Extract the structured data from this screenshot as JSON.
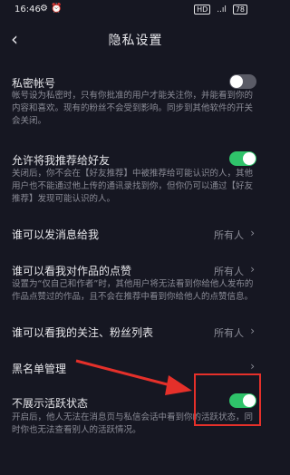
{
  "status_bar": {
    "time": "16:46",
    "left_icons": "⚙ ⏰",
    "hd": "HD",
    "signal": "..ıl",
    "battery": "78"
  },
  "header": {
    "back_icon": "chevron-left",
    "title": "隐私设置"
  },
  "settings": [
    {
      "title": "私密帐号",
      "description": "帐号设为私密时，只有你批准的用户才能关注你，并能看到你的内容和喜欢。现有的粉丝不会受到影响。同步到其他软件的开关会关闭。",
      "toggle": false
    },
    {
      "title": "允许将我推荐给好友",
      "description": "关闭后，你不会在【好友推荐】中被推荐给可能认识的人，其他用户也不能通过他上传的通讯录找到你，但你仍可以通过【好友推荐】发现可能认识的人。",
      "toggle": true
    },
    {
      "title": "谁可以发消息给我",
      "value": "所有人"
    },
    {
      "title": "谁可以看我对作品的点赞",
      "value": "所有人",
      "description": "设置为“仅自己和作者”时，其他用户将无法看到你给他人发布的作品点赞过的作品，且不会在推荐中看到你给他人的点赞信息。"
    },
    {
      "title": "谁可以看我的关注、粉丝列表",
      "value": "所有人"
    },
    {
      "title": "黑名单管理"
    },
    {
      "title": "不展示活跃状态",
      "description": "开启后，他人无法在消息页与私信会话中看到你的活跃状态，同时你也无法查看别人的活跃情况。",
      "toggle": true
    }
  ],
  "colors": {
    "background": "#161722",
    "toggle_on": "#2fc36a",
    "toggle_off": "#5a5b66",
    "annotation": "#e5302a"
  }
}
